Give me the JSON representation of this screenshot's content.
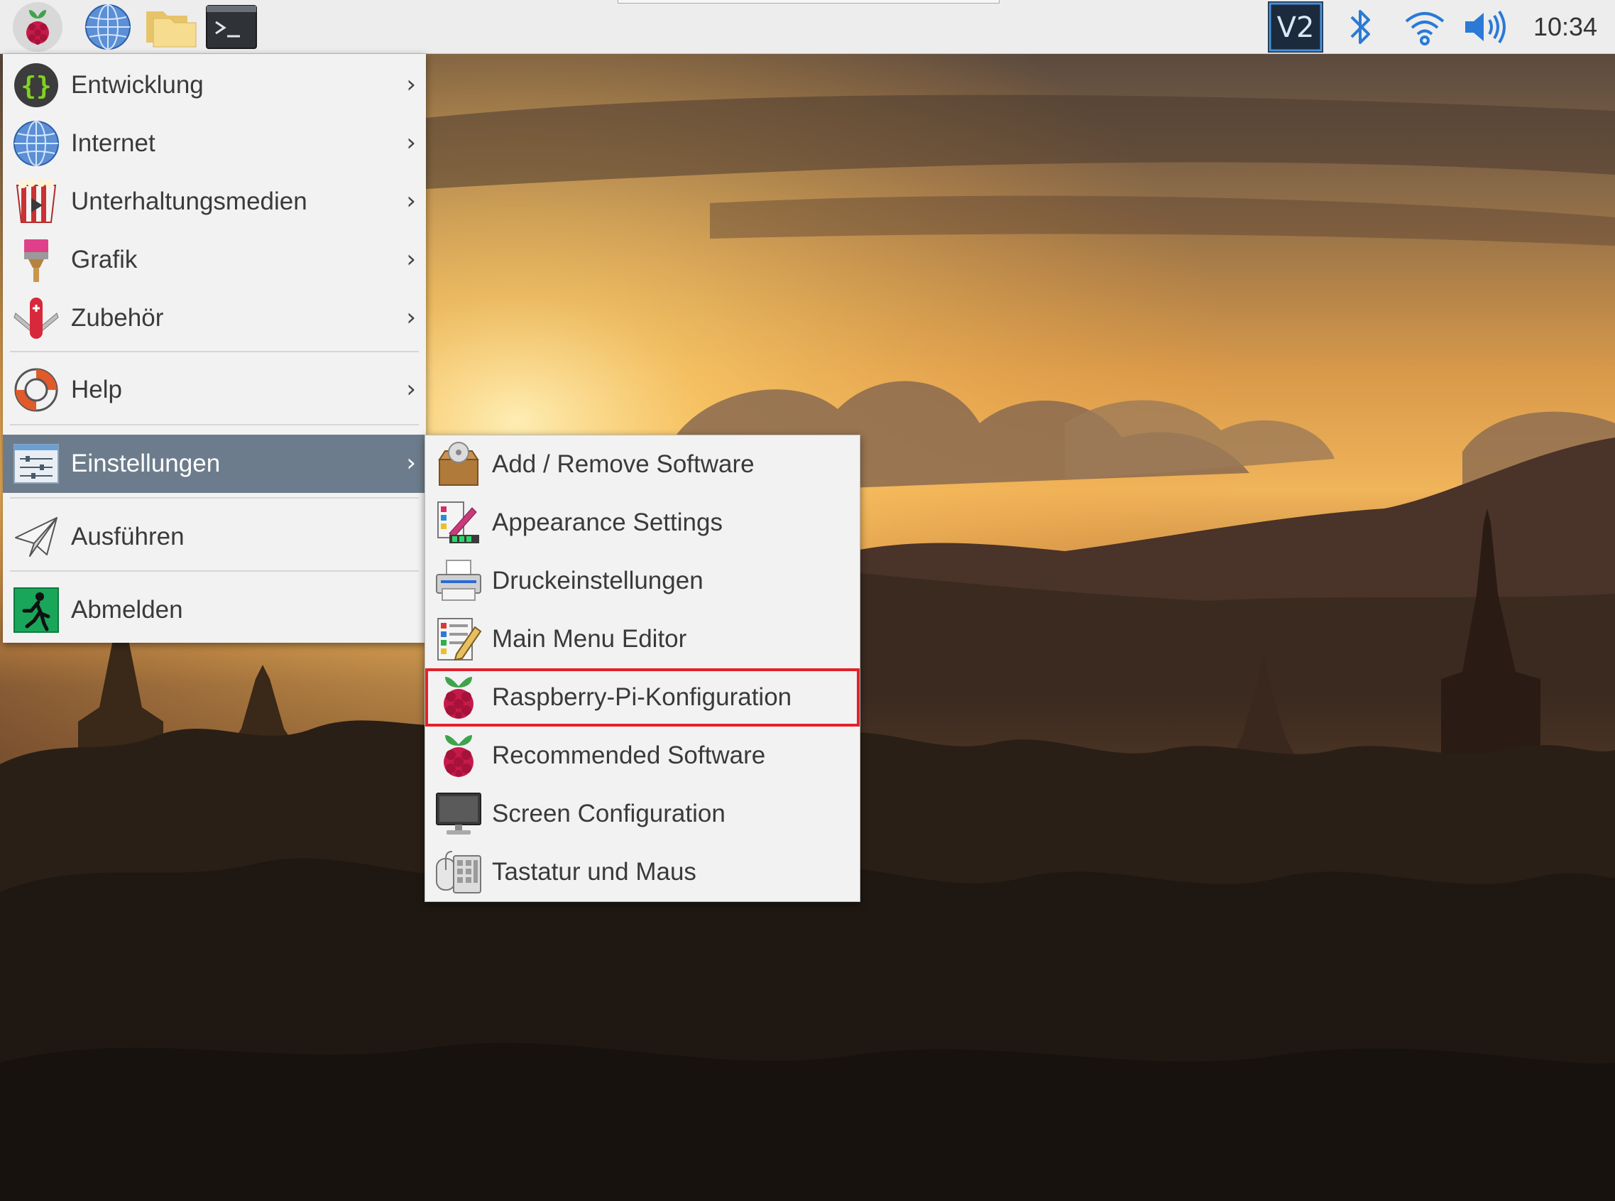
{
  "taskbar": {
    "launchers": [
      {
        "icon": "raspberry-menu-icon"
      },
      {
        "icon": "web-browser-icon"
      },
      {
        "icon": "file-manager-icon"
      },
      {
        "icon": "terminal-icon"
      }
    ],
    "tray": {
      "vnc_label": "V2",
      "clock": "10:34"
    }
  },
  "main_menu": {
    "items": [
      {
        "label": "Entwicklung",
        "icon": "programming-icon",
        "has_submenu": true
      },
      {
        "label": "Internet",
        "icon": "globe-icon",
        "has_submenu": true
      },
      {
        "label": "Unterhaltungsmedien",
        "icon": "multimedia-icon",
        "has_submenu": true
      },
      {
        "label": "Grafik",
        "icon": "paintbrush-icon",
        "has_submenu": true
      },
      {
        "label": "Zubehör",
        "icon": "swiss-knife-icon",
        "has_submenu": true
      },
      {
        "label": "Help",
        "icon": "lifebuoy-icon",
        "has_submenu": true
      },
      {
        "label": "Einstellungen",
        "icon": "settings-sliders-icon",
        "has_submenu": true,
        "active": true
      },
      {
        "label": "Ausführen",
        "icon": "paper-plane-icon",
        "has_submenu": false
      },
      {
        "label": "Abmelden",
        "icon": "exit-icon",
        "has_submenu": false
      }
    ],
    "arrow_glyph": "›"
  },
  "settings_submenu": {
    "items": [
      {
        "label": "Add / Remove Software",
        "icon": "package-icon"
      },
      {
        "label": "Appearance Settings",
        "icon": "appearance-icon"
      },
      {
        "label": "Druckeinstellungen",
        "icon": "printer-icon"
      },
      {
        "label": "Main Menu Editor",
        "icon": "menu-editor-icon"
      },
      {
        "label": "Raspberry-Pi-Konfiguration",
        "icon": "raspberry-icon",
        "highlighted": true
      },
      {
        "label": "Recommended Software",
        "icon": "raspberry-icon"
      },
      {
        "label": "Screen Configuration",
        "icon": "monitor-icon"
      },
      {
        "label": "Tastatur und Maus",
        "icon": "keyboard-mouse-icon"
      }
    ]
  },
  "colors": {
    "menu_active_bg": "#6d7c8c",
    "highlight_border": "#e3212b",
    "menu_bg": "#f2f2f2",
    "taskbar_bg": "#ededed"
  }
}
